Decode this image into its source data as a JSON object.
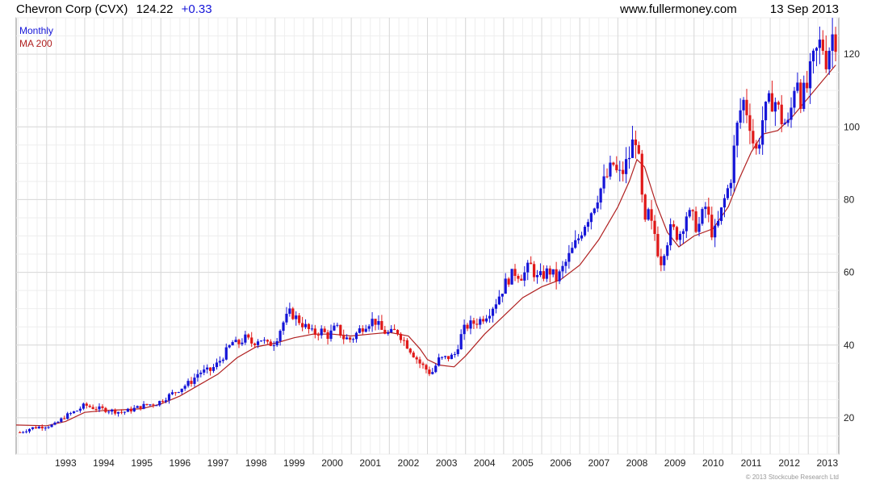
{
  "header": {
    "title": "Chevron Corp (CVX)",
    "price": "124.22",
    "change": "+0.33",
    "site": "www.fullermoney.com",
    "date": "13 Sep 2013"
  },
  "legend": {
    "series_label": "Monthly",
    "ma_label": "MA 200"
  },
  "copyright": "© 2013 Stockcube Research Ltd",
  "colors": {
    "up": "#1515d8",
    "down": "#e01818",
    "ma": "#b02020",
    "title": "#000000",
    "change": "#1515d8",
    "grid": "#d9d9d9",
    "frame": "#888888"
  },
  "chart_data": {
    "type": "candlestick",
    "interval": "Monthly",
    "x_tick_labels": [
      "1993",
      "1994",
      "1995",
      "1996",
      "1997",
      "1998",
      "1999",
      "2000",
      "2001",
      "2002",
      "2003",
      "2004",
      "2005",
      "2006",
      "2007",
      "2008",
      "2009",
      "2010",
      "2011",
      "2012",
      "2013"
    ],
    "y_ticks": [
      20,
      40,
      60,
      80,
      100,
      120
    ],
    "ylim": [
      10,
      130
    ],
    "xlim": [
      1992.2,
      2013.8
    ],
    "grid": true,
    "price_series": {
      "name": "Monthly",
      "points": [
        [
          1992.3,
          16
        ],
        [
          1992.6,
          17.2
        ],
        [
          1992.9,
          17.6
        ],
        [
          1993.2,
          18
        ],
        [
          1993.5,
          20.5
        ],
        [
          1993.8,
          22
        ],
        [
          1994.0,
          23.5
        ],
        [
          1994.2,
          22.8
        ],
        [
          1994.5,
          22.3
        ],
        [
          1994.8,
          21.8
        ],
        [
          1995.0,
          21.5
        ],
        [
          1995.3,
          22.5
        ],
        [
          1995.6,
          23.5
        ],
        [
          1995.9,
          24
        ],
        [
          1996.2,
          26
        ],
        [
          1996.5,
          28
        ],
        [
          1996.8,
          30
        ],
        [
          1997.0,
          32.5
        ],
        [
          1997.3,
          33
        ],
        [
          1997.5,
          35
        ],
        [
          1997.7,
          38
        ],
        [
          1997.9,
          41
        ],
        [
          1998.0,
          40
        ],
        [
          1998.2,
          42
        ],
        [
          1998.4,
          40.5
        ],
        [
          1998.6,
          42
        ],
        [
          1998.8,
          40
        ],
        [
          1999.0,
          41
        ],
        [
          1999.2,
          46
        ],
        [
          1999.4,
          49
        ],
        [
          1999.6,
          47
        ],
        [
          1999.8,
          45
        ],
        [
          2000.0,
          43
        ],
        [
          2000.2,
          44
        ],
        [
          2000.4,
          42.5
        ],
        [
          2000.6,
          45
        ],
        [
          2000.8,
          42
        ],
        [
          2001.0,
          41.5
        ],
        [
          2001.2,
          44
        ],
        [
          2001.4,
          46
        ],
        [
          2001.6,
          47
        ],
        [
          2001.8,
          44
        ],
        [
          2002.0,
          43
        ],
        [
          2002.2,
          44
        ],
        [
          2002.4,
          41
        ],
        [
          2002.6,
          38
        ],
        [
          2002.8,
          35
        ],
        [
          2003.0,
          33
        ],
        [
          2003.1,
          32
        ],
        [
          2003.3,
          36
        ],
        [
          2003.5,
          36.5
        ],
        [
          2003.7,
          37
        ],
        [
          2003.9,
          43
        ],
        [
          2004.0,
          45
        ],
        [
          2004.2,
          46
        ],
        [
          2004.4,
          47
        ],
        [
          2004.6,
          49
        ],
        [
          2004.8,
          52
        ],
        [
          2004.95,
          55
        ],
        [
          2005.1,
          58
        ],
        [
          2005.3,
          60
        ],
        [
          2005.5,
          59
        ],
        [
          2005.7,
          62
        ],
        [
          2005.9,
          58
        ],
        [
          2006.0,
          59
        ],
        [
          2006.2,
          60.5
        ],
        [
          2006.4,
          58
        ],
        [
          2006.6,
          62
        ],
        [
          2006.8,
          66
        ],
        [
          2006.95,
          69
        ],
        [
          2007.1,
          73
        ],
        [
          2007.3,
          77
        ],
        [
          2007.5,
          82
        ],
        [
          2007.7,
          86
        ],
        [
          2007.9,
          90
        ],
        [
          2008.0,
          86
        ],
        [
          2008.15,
          88
        ],
        [
          2008.3,
          92
        ],
        [
          2008.45,
          98
        ],
        [
          2008.5,
          96
        ],
        [
          2008.6,
          84
        ],
        [
          2008.7,
          72
        ],
        [
          2008.8,
          76
        ],
        [
          2008.9,
          72
        ],
        [
          2009.0,
          70
        ],
        [
          2009.1,
          62
        ],
        [
          2009.2,
          66
        ],
        [
          2009.4,
          72
        ],
        [
          2009.6,
          70
        ],
        [
          2009.8,
          76
        ],
        [
          2009.95,
          75
        ],
        [
          2010.1,
          72
        ],
        [
          2010.3,
          78
        ],
        [
          2010.5,
          70
        ],
        [
          2010.6,
          72
        ],
        [
          2010.8,
          80
        ],
        [
          2010.95,
          85
        ],
        [
          2011.1,
          98
        ],
        [
          2011.2,
          104
        ],
        [
          2011.3,
          107
        ],
        [
          2011.4,
          104
        ],
        [
          2011.5,
          100
        ],
        [
          2011.6,
          92
        ],
        [
          2011.7,
          96
        ],
        [
          2011.8,
          102
        ],
        [
          2011.95,
          106
        ],
        [
          2012.1,
          108
        ],
        [
          2012.2,
          105
        ],
        [
          2012.3,
          102
        ],
        [
          2012.5,
          100
        ],
        [
          2012.6,
          110
        ],
        [
          2012.7,
          115
        ],
        [
          2012.8,
          108
        ],
        [
          2012.95,
          110
        ],
        [
          2013.1,
          117
        ],
        [
          2013.2,
          120
        ],
        [
          2013.35,
          124
        ],
        [
          2013.45,
          118
        ],
        [
          2013.55,
          122
        ],
        [
          2013.65,
          126
        ],
        [
          2013.72,
          124.22
        ]
      ]
    },
    "ma_series": {
      "name": "MA 200",
      "points": [
        [
          1992.2,
          18
        ],
        [
          1993.0,
          17.8
        ],
        [
          1993.5,
          19
        ],
        [
          1994.0,
          21.5
        ],
        [
          1994.5,
          22
        ],
        [
          1995.0,
          22.2
        ],
        [
          1995.5,
          22.5
        ],
        [
          1996.0,
          23.8
        ],
        [
          1996.5,
          26
        ],
        [
          1997.0,
          29
        ],
        [
          1997.5,
          32
        ],
        [
          1998.0,
          36.5
        ],
        [
          1998.5,
          39.5
        ],
        [
          1999.0,
          40.5
        ],
        [
          1999.5,
          42
        ],
        [
          2000.0,
          43
        ],
        [
          2000.5,
          43
        ],
        [
          2001.0,
          42.5
        ],
        [
          2001.5,
          43
        ],
        [
          2002.0,
          43.5
        ],
        [
          2002.5,
          42.5
        ],
        [
          2002.8,
          39
        ],
        [
          2003.0,
          36
        ],
        [
          2003.3,
          34.5
        ],
        [
          2003.7,
          34
        ],
        [
          2004.0,
          37
        ],
        [
          2004.5,
          43
        ],
        [
          2005.0,
          48
        ],
        [
          2005.5,
          53
        ],
        [
          2006.0,
          56
        ],
        [
          2006.5,
          58
        ],
        [
          2007.0,
          62
        ],
        [
          2007.5,
          69
        ],
        [
          2008.0,
          78
        ],
        [
          2008.3,
          85
        ],
        [
          2008.5,
          91
        ],
        [
          2008.7,
          89
        ],
        [
          2009.0,
          79
        ],
        [
          2009.3,
          71
        ],
        [
          2009.6,
          67
        ],
        [
          2010.0,
          70
        ],
        [
          2010.5,
          72
        ],
        [
          2010.9,
          78
        ],
        [
          2011.2,
          86
        ],
        [
          2011.5,
          93
        ],
        [
          2011.8,
          98
        ],
        [
          2012.2,
          99
        ],
        [
          2012.6,
          103
        ],
        [
          2013.0,
          108
        ],
        [
          2013.4,
          113
        ],
        [
          2013.72,
          117
        ]
      ]
    }
  }
}
